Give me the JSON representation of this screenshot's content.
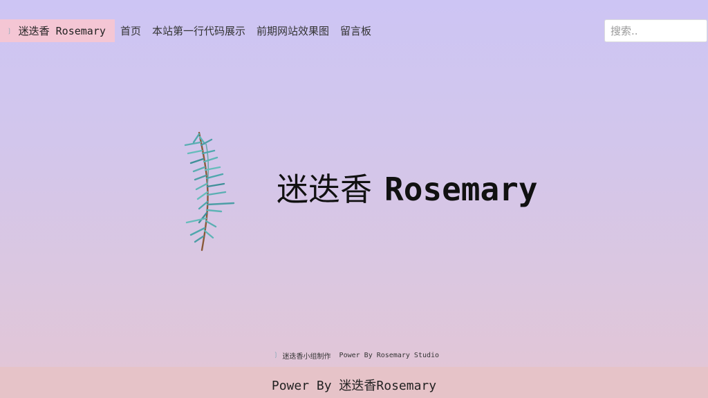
{
  "navbar": {
    "brand_icon": "❳",
    "brand_label": "迷迭香 Rosemary",
    "links": [
      "首页",
      "本站第一行代码展示",
      "前期网站效果图",
      "留言板"
    ],
    "search_placeholder": "搜索.."
  },
  "hero": {
    "title_cn": "迷迭香",
    "title_en": "Rosemary",
    "image": "rosemary-sprig"
  },
  "credit": {
    "icon": "❳",
    "team": "迷迭香小组制作",
    "studio": "Power By Rosemary Studio"
  },
  "footer": {
    "text": "Power By 迷迭香Rosemary"
  },
  "colors": {
    "brand_bg": "#f4c6d4",
    "footer_bg": "#e6c3c8",
    "bg_top": "#cdc5f4",
    "bg_bottom": "#e4c6d4"
  }
}
